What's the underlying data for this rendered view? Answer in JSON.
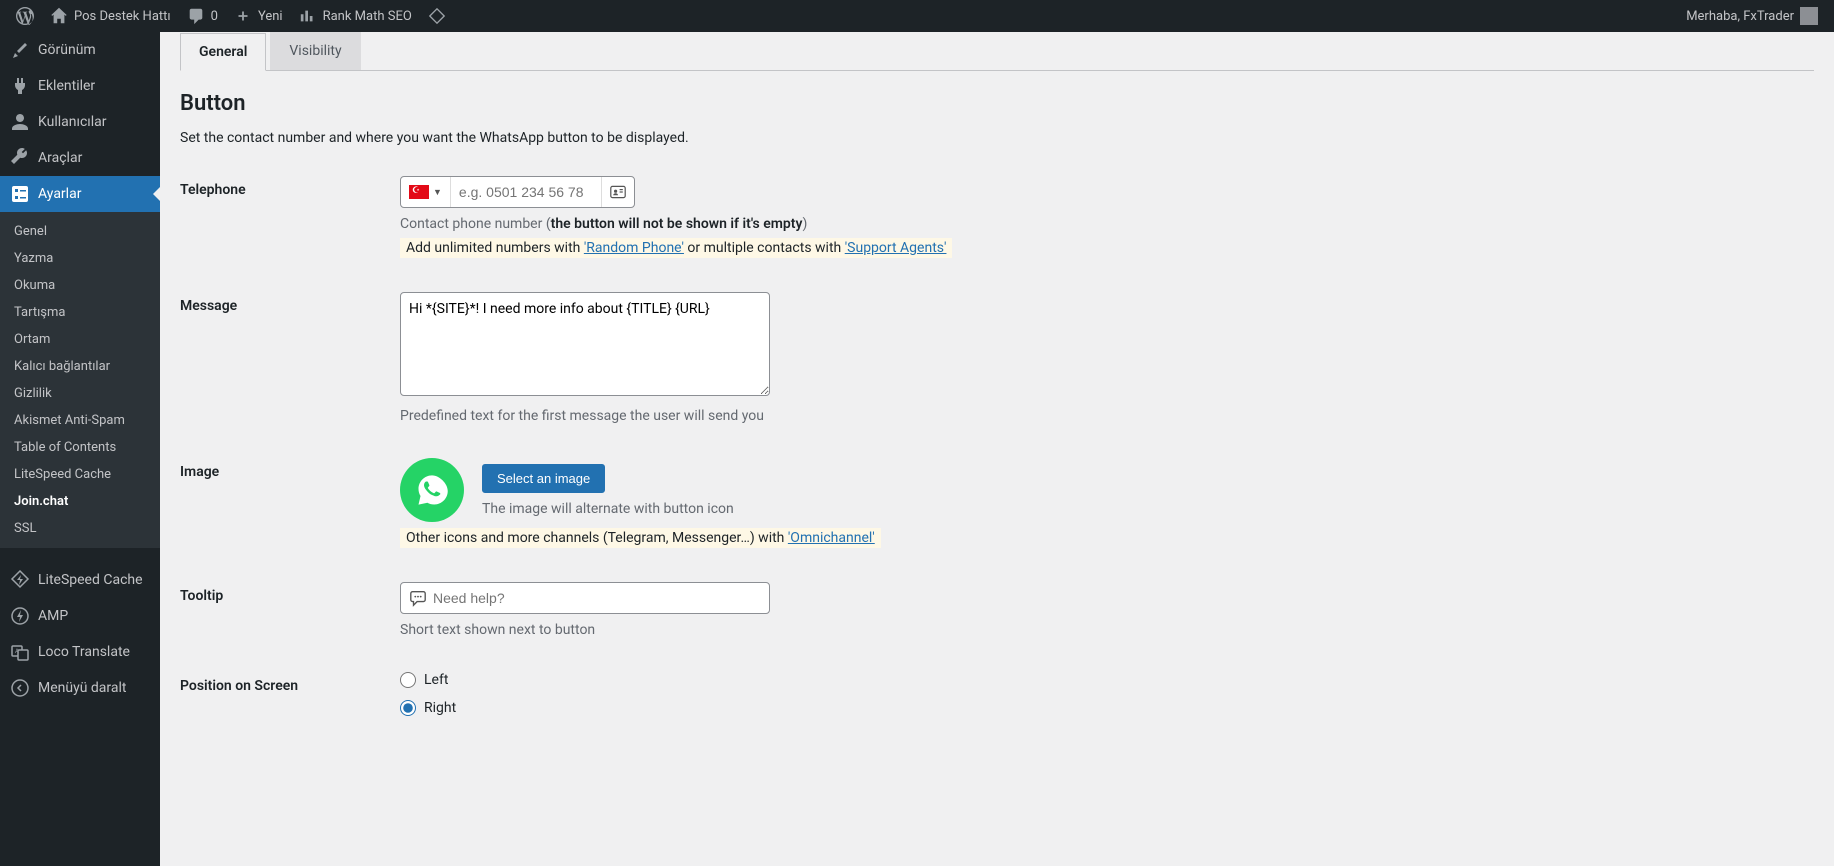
{
  "adminbar": {
    "site_name": "Pos Destek Hattı",
    "comments_count": "0",
    "new_label": "Yeni",
    "rankmath_label": "Rank Math SEO",
    "greeting": "Merhaba, FxTrader"
  },
  "sidebar": {
    "items": [
      {
        "label": "Görünüm",
        "icon": "brush"
      },
      {
        "label": "Eklentiler",
        "icon": "plug"
      },
      {
        "label": "Kullanıcılar",
        "icon": "user"
      },
      {
        "label": "Araçlar",
        "icon": "wrench"
      },
      {
        "label": "Ayarlar",
        "icon": "sliders",
        "current": true
      }
    ],
    "submenu": [
      "Genel",
      "Yazma",
      "Okuma",
      "Tartışma",
      "Ortam",
      "Kalıcı bağlantılar",
      "Gizlilik",
      "Akismet Anti-Spam",
      "Table of Contents",
      "LiteSpeed Cache",
      "Join.chat",
      "SSL"
    ],
    "submenu_active": "Join.chat",
    "bottom": [
      {
        "label": "LiteSpeed Cache",
        "icon": "bolt"
      },
      {
        "label": "AMP",
        "icon": "amp"
      },
      {
        "label": "Loco Translate",
        "icon": "translate"
      },
      {
        "label": "Menüyü daralt",
        "icon": "collapse"
      }
    ]
  },
  "tabs": {
    "general": "General",
    "visibility": "Visibility"
  },
  "section": {
    "title": "Button",
    "desc": "Set the contact number and where you want the WhatsApp button to be displayed."
  },
  "telephone": {
    "label": "Telephone",
    "placeholder": "e.g. 0501 234 56 78",
    "desc_prefix": "Contact phone number (",
    "desc_bold": "the button will not be shown if it's empty",
    "desc_suffix": ")",
    "hint_prefix": "Add unlimited numbers with ",
    "hint_link1": "'Random Phone'",
    "hint_mid": " or multiple contacts with ",
    "hint_link2": "'Support Agents'"
  },
  "message": {
    "label": "Message",
    "value": "Hi *{SITE}*! I need more info about {TITLE} {URL}",
    "desc": "Predefined text for the first message the user will send you"
  },
  "image": {
    "label": "Image",
    "button": "Select an image",
    "desc": "The image will alternate with button icon",
    "hint_prefix": "Other icons and more channels (Telegram, Messenger…) with ",
    "hint_link": "'Omnichannel'"
  },
  "tooltip": {
    "label": "Tooltip",
    "placeholder": "Need help?",
    "desc": "Short text shown next to button"
  },
  "position": {
    "label": "Position on Screen",
    "left": "Left",
    "right": "Right"
  }
}
